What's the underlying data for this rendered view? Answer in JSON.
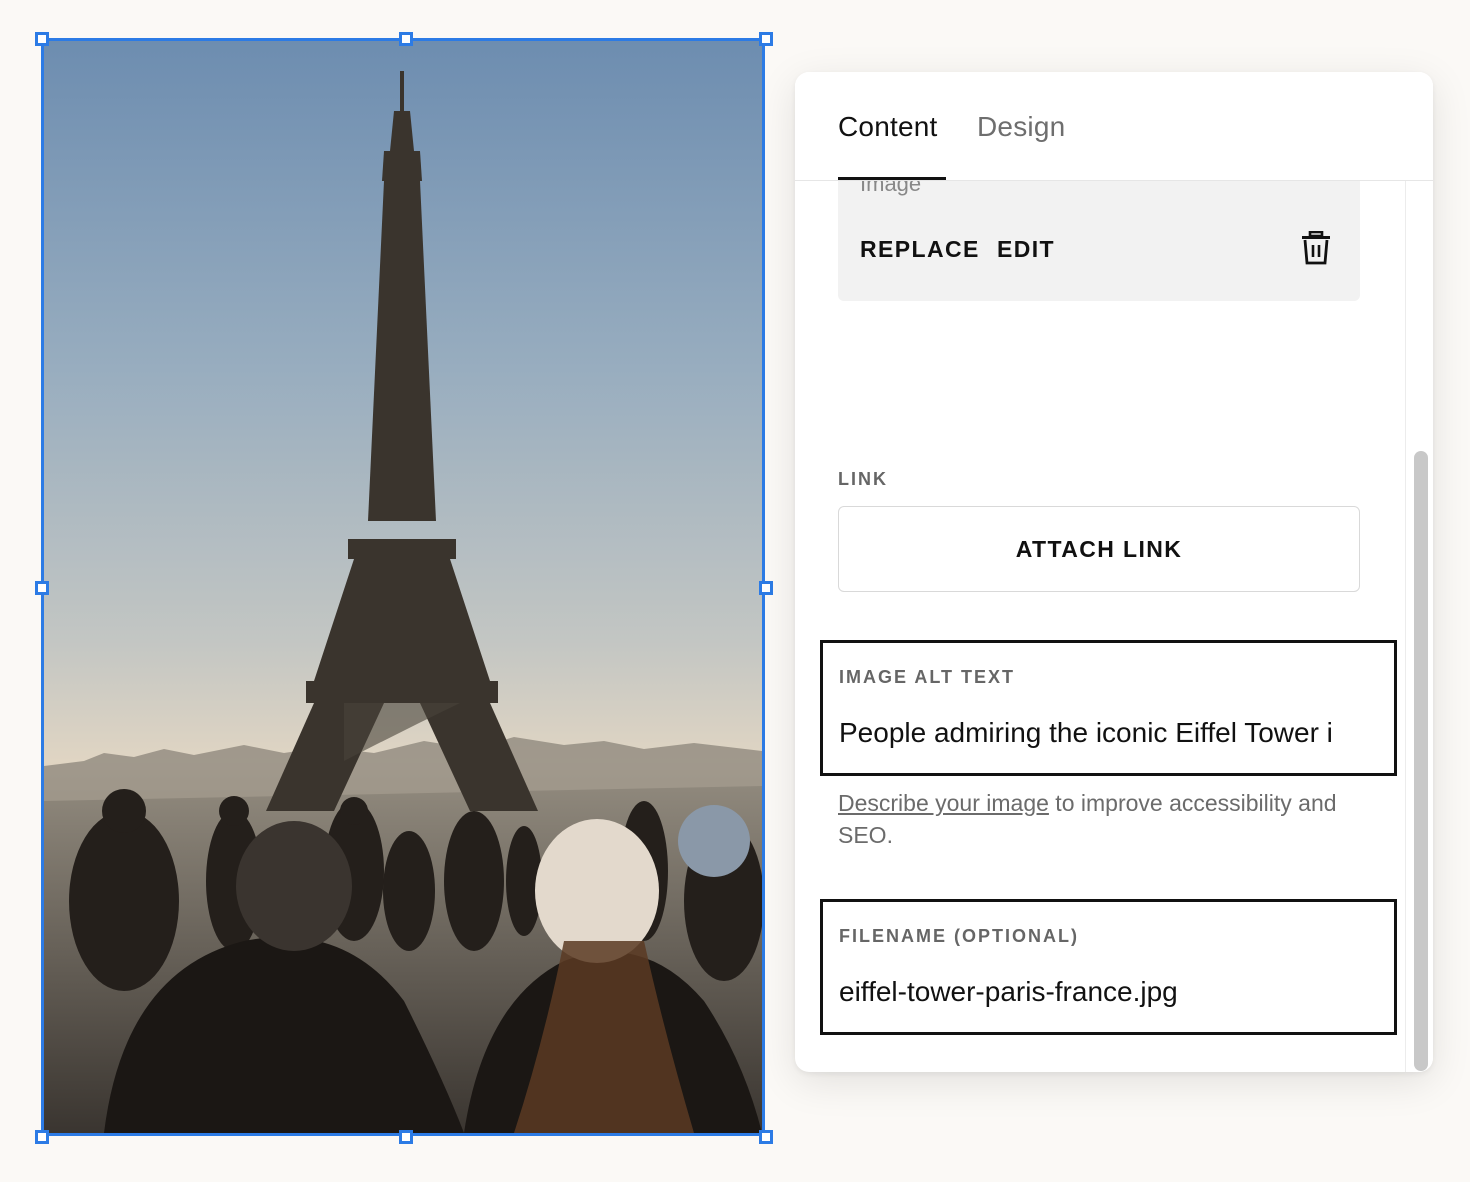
{
  "canvas": {
    "selected_image_alt": "People admiring the iconic Eiffel Tower in Paris",
    "selection_color": "#2c7be5"
  },
  "panel": {
    "tabs": [
      {
        "label": "Content",
        "active": true
      },
      {
        "label": "Design",
        "active": false
      }
    ],
    "image_section": {
      "peek_label": "Image",
      "replace_label": "REPLACE",
      "edit_label": "EDIT",
      "delete_icon": "trash-icon"
    },
    "link": {
      "label": "LINK",
      "button_label": "ATTACH LINK"
    },
    "alt_text": {
      "label": "IMAGE ALT TEXT",
      "value": "People admiring the iconic Eiffel Tower i"
    },
    "helper": {
      "link_text": "Describe your image",
      "rest_text": " to improve accessibility and SEO."
    },
    "filename": {
      "label": "FILENAME (OPTIONAL)",
      "value": "eiffel-tower-paris-france.jpg"
    }
  }
}
